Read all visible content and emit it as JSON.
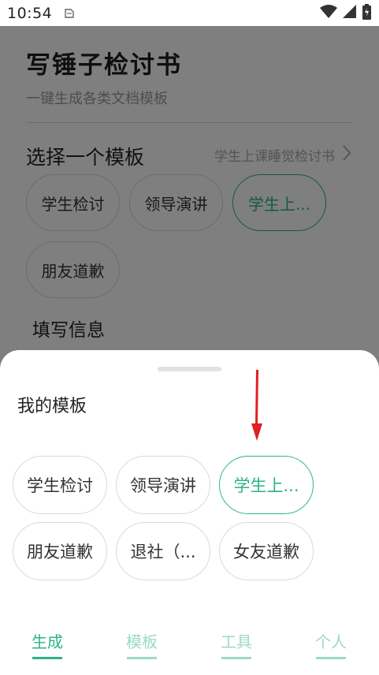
{
  "status_bar": {
    "time": "10:54"
  },
  "page": {
    "title": "写锤子检讨书",
    "subtitle": "一键生成各类文档模板",
    "section_title": "选择一个模板",
    "current_template": "学生上课睡觉检讨书",
    "templates": [
      "学生检讨",
      "领导演讲",
      "学生上...",
      "朋友道歉"
    ],
    "selected_index": 2,
    "fill_title": "填写信息"
  },
  "sheet": {
    "title": "我的模板",
    "chips": [
      "学生检讨",
      "领导演讲",
      "学生上...",
      "朋友道歉",
      "退社（...",
      "女友道歉"
    ],
    "selected_index": 2
  },
  "bottom_nav": {
    "items": [
      "生成",
      "模板",
      "工具",
      "个人"
    ],
    "active_index": 0
  },
  "colors": {
    "accent": "#2bb38a",
    "accent_light": "#9adbc7",
    "annotation_arrow": "#e02020"
  }
}
